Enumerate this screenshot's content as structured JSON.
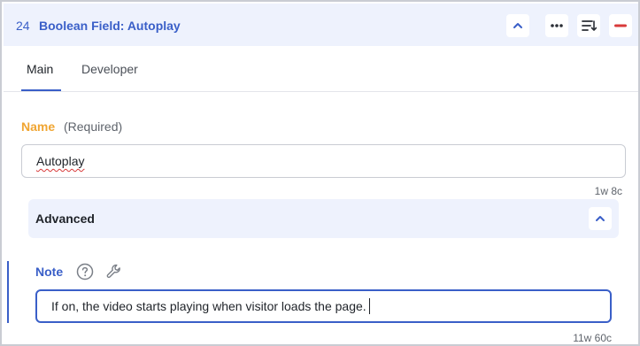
{
  "header": {
    "number": "24",
    "title": "Boolean Field: Autoplay",
    "icons": [
      "chevron-up-icon",
      "more-icon",
      "list-sort-icon",
      "minus-icon"
    ],
    "colors": {
      "accent": "#3a5fc8",
      "danger": "#d83a3a",
      "header_bg": "#eef2fd"
    }
  },
  "tabs": [
    {
      "label": "Main",
      "active": true
    },
    {
      "label": "Developer",
      "active": false
    }
  ],
  "name_field": {
    "label": "Name",
    "required_text": "(Required)",
    "value": "Autoplay",
    "count": "1w 8c",
    "label_color": "#f0a532"
  },
  "advanced": {
    "label": "Advanced",
    "icon": "chevron-up-icon"
  },
  "note_field": {
    "label": "Note",
    "icons": [
      "help-icon",
      "wrench-icon"
    ],
    "value": "If on, the video starts playing when visitor loads the page.",
    "count": "11w 60c"
  }
}
